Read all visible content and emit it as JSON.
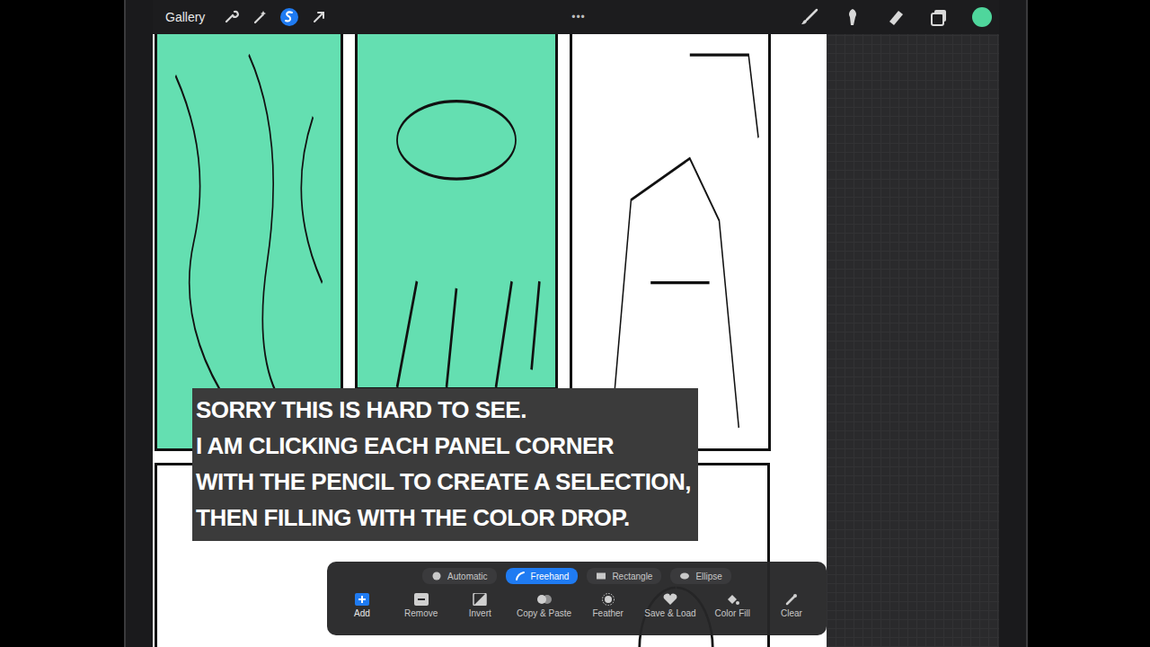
{
  "topbar": {
    "gallery": "Gallery",
    "left_tools": [
      {
        "kind": "actions",
        "selected": false
      },
      {
        "kind": "adjustments",
        "selected": false
      },
      {
        "kind": "selection",
        "selected": true
      },
      {
        "kind": "transform",
        "selected": false
      }
    ],
    "more": "•••",
    "right_tools": [
      {
        "kind": "brush",
        "selected": false
      },
      {
        "kind": "smudge",
        "selected": false
      },
      {
        "kind": "eraser",
        "selected": false
      },
      {
        "kind": "layers",
        "selected": false
      }
    ],
    "current_color": "#4fd69c"
  },
  "canvas": {
    "fill_color": "#64dfb1",
    "panels": [
      {
        "kind": "crowd",
        "filled": true
      },
      {
        "kind": "creature",
        "filled": true
      },
      {
        "kind": "landscape",
        "filled": false
      },
      {
        "kind": "wide",
        "filled": false
      }
    ]
  },
  "caption": {
    "lines": [
      "SORRY THIS IS HARD TO SEE.",
      "I AM CLICKING EACH PANEL CORNER",
      "WITH THE PENCIL TO CREATE A SELECTION,",
      "THEN FILLING WITH THE COLOR DROP."
    ]
  },
  "selection_toolbar": {
    "modes": [
      {
        "kind": "automatic",
        "label": "Automatic",
        "selected": false
      },
      {
        "kind": "freehand",
        "label": "Freehand",
        "selected": true
      },
      {
        "kind": "rectangle",
        "label": "Rectangle",
        "selected": false
      },
      {
        "kind": "ellipse",
        "label": "Ellipse",
        "selected": false
      }
    ],
    "actions": [
      {
        "kind": "add",
        "label": "Add",
        "selected": true
      },
      {
        "kind": "remove",
        "label": "Remove",
        "selected": false
      },
      {
        "kind": "invert",
        "label": "Invert",
        "selected": false
      },
      {
        "kind": "copy",
        "label": "Copy & Paste",
        "selected": false
      },
      {
        "kind": "feather",
        "label": "Feather",
        "selected": false
      },
      {
        "kind": "save",
        "label": "Save & Load",
        "selected": false
      },
      {
        "kind": "fill",
        "label": "Color Fill",
        "selected": false
      },
      {
        "kind": "clear",
        "label": "Clear",
        "selected": false
      }
    ]
  }
}
